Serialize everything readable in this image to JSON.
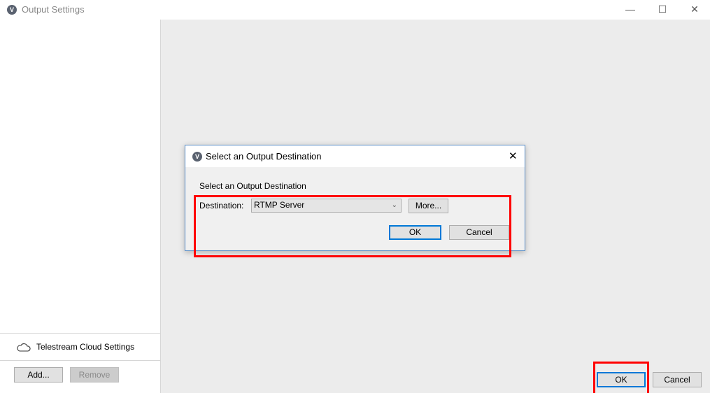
{
  "window": {
    "title": "Output Settings",
    "minimize": "—",
    "maximize": "☐",
    "close": "✕"
  },
  "sidebar": {
    "cloud_settings": "Telestream Cloud Settings",
    "add": "Add...",
    "remove": "Remove"
  },
  "footer": {
    "ok": "OK",
    "cancel": "Cancel"
  },
  "dialog": {
    "title": "Select an Output Destination",
    "close": "✕",
    "heading": "Select an Output Destination",
    "destination_label": "Destination:",
    "destination_value": "RTMP Server",
    "more": "More...",
    "ok": "OK",
    "cancel": "Cancel"
  },
  "colors": {
    "highlight": "#ff0000",
    "accent": "#0078d7"
  }
}
